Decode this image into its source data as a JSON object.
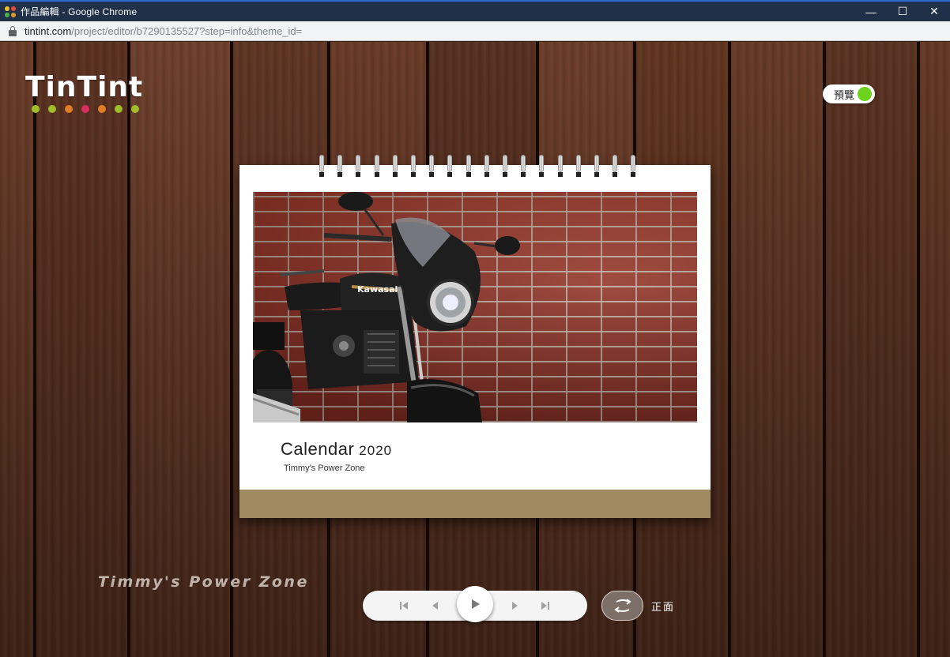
{
  "window": {
    "title": "作品編輯 - Google Chrome",
    "minimize": "—",
    "maximize": "☐",
    "close": "✕"
  },
  "address": {
    "host": "tintint.com",
    "path": "/project/editor/b7290135527?step=info&theme_id="
  },
  "app": {
    "logo": "TinTint",
    "logo_dot_colors": [
      "#9fbe2a",
      "#9fbe2a",
      "#e07d28",
      "#d92d5f",
      "#e07d28",
      "#9fbe2a",
      "#9fbe2a"
    ],
    "preview_label": "預覽",
    "preview_on_color": "#6cd21e"
  },
  "calendar": {
    "title": "Calendar",
    "year": "2020",
    "subtitle": "Timmy's Power Zone",
    "base_color": "#a08a62"
  },
  "watermark": "Timmy's Power Zone",
  "player": {
    "buttons": [
      "first-page-icon",
      "prev-page-icon",
      "play-icon",
      "next-page-icon",
      "last-page-icon"
    ],
    "flip_icon": "flip-icon",
    "side_label": "正面"
  }
}
